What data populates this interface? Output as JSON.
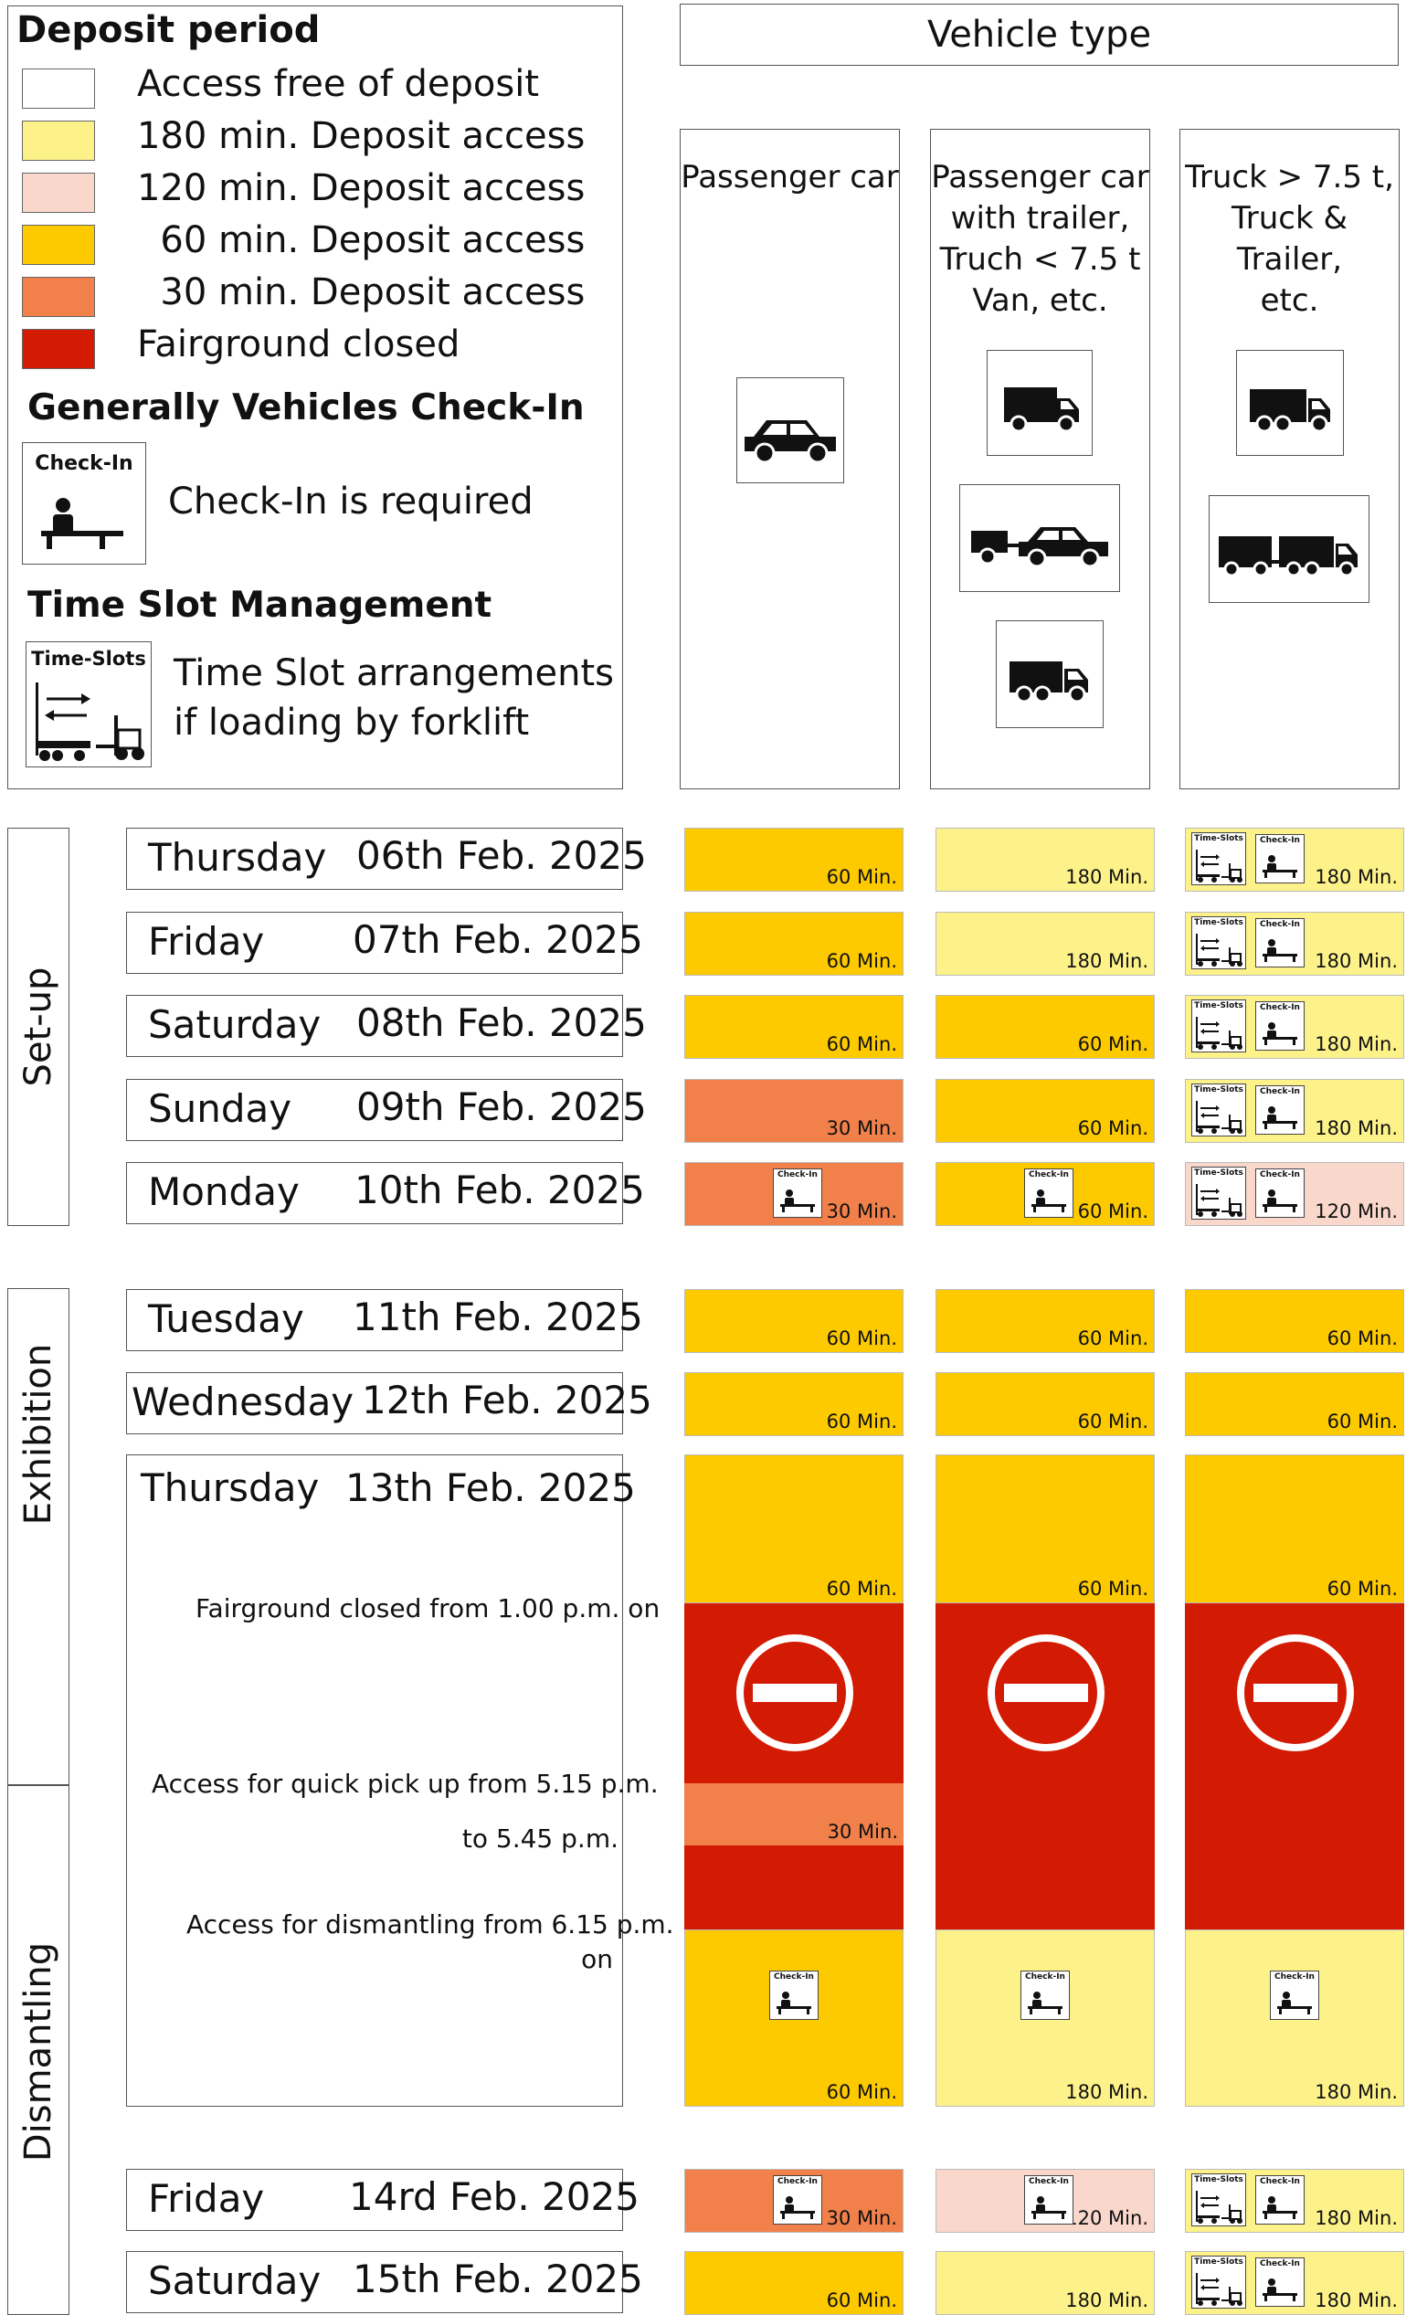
{
  "legend": {
    "deposit_title": "Deposit period",
    "items": [
      {
        "color": "#ffffff",
        "label": "Access free of deposit"
      },
      {
        "color": "#fdf28a",
        "label": "180 min. Deposit access"
      },
      {
        "color": "#f9d7cb",
        "label": "120 min. Deposit access"
      },
      {
        "color": "#fdca00",
        "label": "  60 min. Deposit access"
      },
      {
        "color": "#f1804a",
        "label": "  30 min. Deposit access"
      },
      {
        "color": "#d31a02",
        "label": "Fairground closed"
      }
    ],
    "checkin_title": "Generally Vehicles Check-In",
    "checkin_icon_label": "Check-In",
    "checkin_text": "Check-In is required",
    "timeslot_title": "Time Slot Management",
    "timeslot_icon_label": "Time-Slots",
    "timeslot_text_1": "Time Slot arrangements",
    "timeslot_text_2": "if loading by forklift"
  },
  "vehicle_header": "Vehicle type",
  "columns": [
    {
      "label": "Passenger car"
    },
    {
      "label": "Passenger car\nwith trailer,\nTruch < 7.5 t\nVan, etc."
    },
    {
      "label": "Truck > 7.5 t,\nTruck & Trailer,\netc."
    }
  ],
  "phases": {
    "setup": "Set-up",
    "exhibition": "Exhibition",
    "dismantling": "Dismantling"
  },
  "days": [
    {
      "day": "Thursday",
      "date": "06th Feb. 2025"
    },
    {
      "day": "Friday",
      "date": "07th Feb. 2025"
    },
    {
      "day": "Saturday",
      "date": "08th Feb. 2025"
    },
    {
      "day": "Sunday",
      "date": "09th Feb. 2025"
    },
    {
      "day": "Monday",
      "date": "10th Feb. 2025"
    },
    {
      "day": "Tuesday",
      "date": "11th Feb. 2025"
    },
    {
      "day": "Wednesday",
      "date": "12th Feb. 2025"
    },
    {
      "day": "Thursday",
      "date": "13th Feb. 2025"
    },
    {
      "day": "Friday",
      "date": "14rd Feb. 2025"
    },
    {
      "day": "Saturday",
      "date": "15th Feb. 2025"
    }
  ],
  "thursday_notes": {
    "closed": "Fairground closed from 1.00 p.m. on",
    "pickup_1": "Access for quick pick up from  5.15 p.m.",
    "pickup_2": "to 5.45 p.m.",
    "dismantle_1": "Access for dismantling from 6.15 p.m.",
    "dismantle_2": "on"
  },
  "grid": [
    [
      "60 Min.",
      "180 Min.",
      "180 Min."
    ],
    [
      "60 Min.",
      "180 Min.",
      "180 Min."
    ],
    [
      "60 Min.",
      "60 Min.",
      "180 Min."
    ],
    [
      "30 Min.",
      "60 Min.",
      "180 Min."
    ],
    [
      "30 Min.",
      "60 Min.",
      "120 Min."
    ],
    [
      "60 Min.",
      "60 Min.",
      "60 Min."
    ],
    [
      "60 Min.",
      "60 Min.",
      "60 Min."
    ],
    [
      "30 Min.",
      "120 Min.",
      "180 Min."
    ],
    [
      "60 Min.",
      "180 Min.",
      "180 Min."
    ]
  ],
  "thursday_grid": {
    "morning": [
      "60 Min.",
      "60 Min.",
      "60 Min."
    ],
    "pickup": "30 Min.",
    "dismantle": [
      "60 Min.",
      "180 Min.",
      "180 Min."
    ]
  },
  "colors": {
    "yellow_180": "#fdf28a",
    "pink_120": "#f9d7cb",
    "gold_60": "#fdca00",
    "orange_30": "#f1804a",
    "red_closed": "#d31a02"
  }
}
